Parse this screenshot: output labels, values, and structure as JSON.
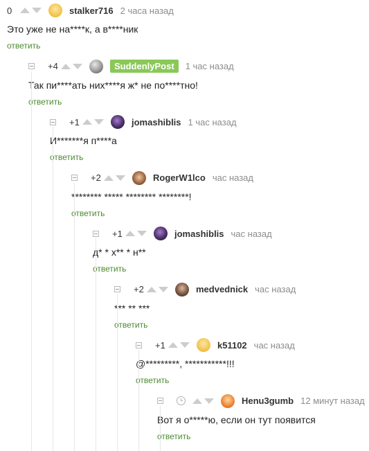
{
  "reply_label": "ответить",
  "colors": {
    "reply": "#4b8a2f",
    "badge": "#8ac858",
    "vote": "#cccccc"
  },
  "comments": [
    {
      "rating": "0",
      "author": "stalker716",
      "time": "2 часа назад",
      "text": "Это уже не на****к, а в****ник",
      "avatar": "avatar-yellow",
      "collapse": false,
      "clock": false,
      "badge": false
    },
    {
      "rating": "+4",
      "author": "SuddenlyPost",
      "time": "1 час назад",
      "text": "Так пи****ать них****я ж* не по****тно!",
      "avatar": "avatar-grey",
      "collapse": true,
      "clock": false,
      "badge": true
    },
    {
      "rating": "+1",
      "author": "jomashiblis",
      "time": "1 час назад",
      "text": "И*******я п****а",
      "avatar": "avatar-dark",
      "collapse": true,
      "clock": false,
      "badge": false
    },
    {
      "rating": "+2",
      "author": "RogerW1lco",
      "time": "час назад",
      "text": "******** ***** ******** ********!",
      "avatar": "avatar-face",
      "collapse": true,
      "clock": false,
      "badge": false
    },
    {
      "rating": "+1",
      "author": "jomashiblis",
      "time": "час назад",
      "text": "д* * х** * н**",
      "avatar": "avatar-dark",
      "collapse": true,
      "clock": false,
      "badge": false
    },
    {
      "rating": "+2",
      "author": "medvednick",
      "time": "час назад",
      "text": "*** ** ***",
      "avatar": "avatar-brown",
      "collapse": true,
      "clock": false,
      "badge": false
    },
    {
      "rating": "+1",
      "author": "k51102",
      "time": "час назад",
      "text": "@*********, ***********!!!",
      "avatar": "avatar-yellow",
      "collapse": true,
      "clock": false,
      "badge": false
    },
    {
      "rating": "",
      "author": "Henu3gumb",
      "time": "12 минут назад",
      "text": "Вот я о*****ю, если он тут появится",
      "avatar": "avatar-orange",
      "collapse": true,
      "clock": true,
      "badge": false
    }
  ]
}
